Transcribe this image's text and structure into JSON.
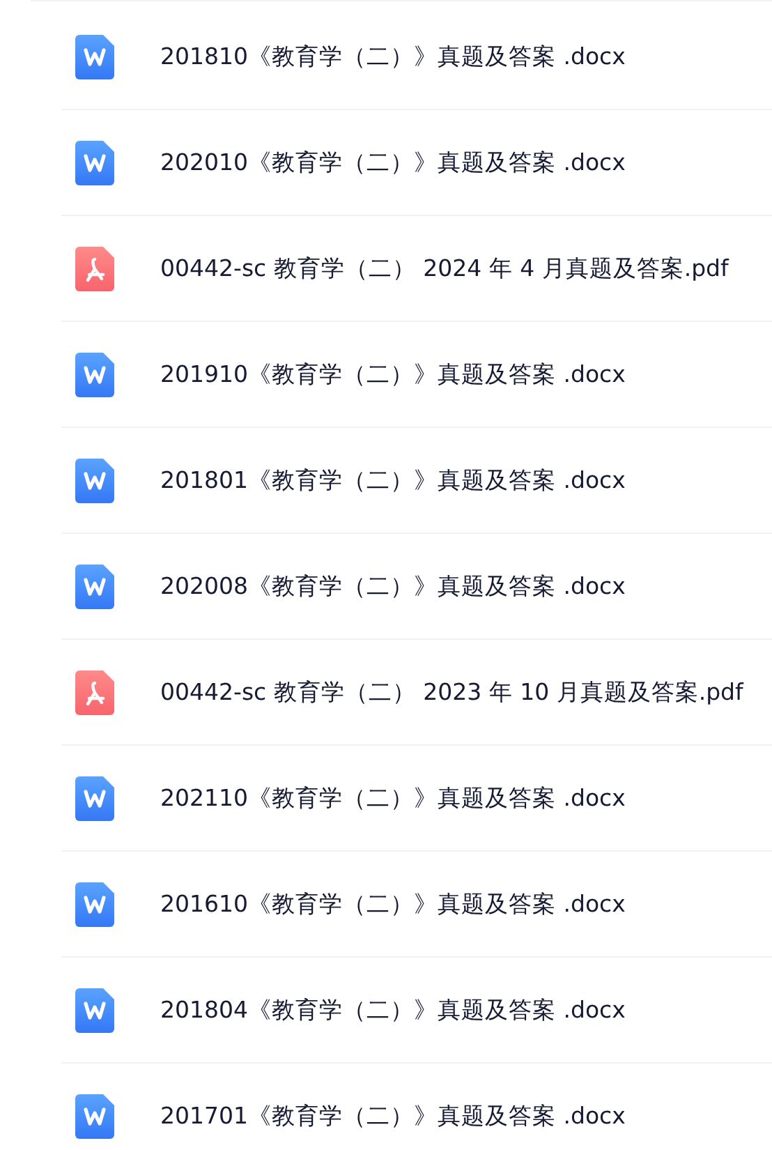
{
  "files": [
    {
      "kind": "word",
      "name": "201810《教育学（二）》真题及答案 .docx"
    },
    {
      "kind": "word",
      "name": "202010《教育学（二）》真题及答案 .docx"
    },
    {
      "kind": "pdf",
      "name": "00442-sc 教育学（二） 2024 年 4 月真题及答案.pdf"
    },
    {
      "kind": "word",
      "name": "201910《教育学（二）》真题及答案 .docx"
    },
    {
      "kind": "word",
      "name": "201801《教育学（二）》真题及答案 .docx"
    },
    {
      "kind": "word",
      "name": "202008《教育学（二）》真题及答案 .docx"
    },
    {
      "kind": "pdf",
      "name": "00442-sc 教育学（二） 2023 年 10 月真题及答案.pdf"
    },
    {
      "kind": "word",
      "name": "202110《教育学（二）》真题及答案 .docx"
    },
    {
      "kind": "word",
      "name": "201610《教育学（二）》真题及答案 .docx"
    },
    {
      "kind": "word",
      "name": "201804《教育学（二）》真题及答案 .docx"
    },
    {
      "kind": "word",
      "name": "201701《教育学（二）》真题及答案 .docx"
    }
  ]
}
